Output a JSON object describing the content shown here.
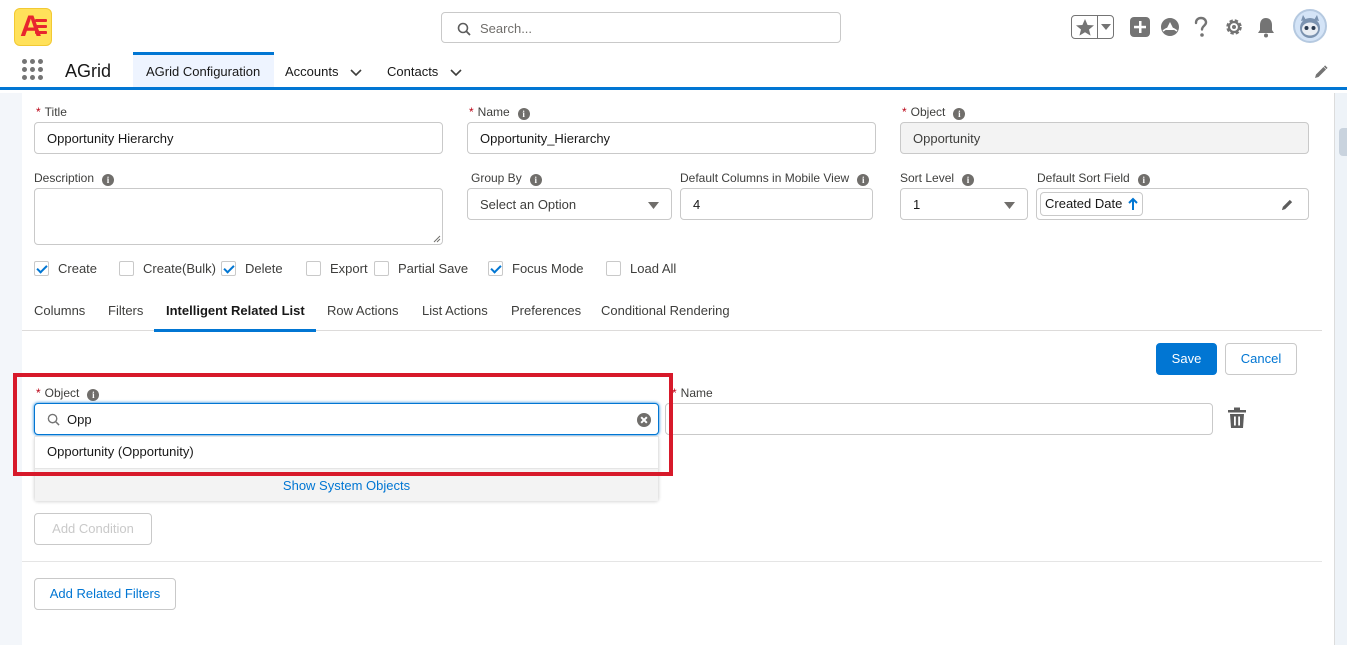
{
  "header": {
    "search_placeholder": "Search...",
    "icons": [
      "favorites-star-icon",
      "add-icon",
      "trailhead-icon",
      "help-icon",
      "setup-gear-icon",
      "notifications-bell-icon",
      "user-avatar"
    ]
  },
  "nav": {
    "app_name": "AGrid",
    "tabs": [
      {
        "label": "AGrid Configuration",
        "active": true
      },
      {
        "label": "Accounts",
        "has_menu": true
      },
      {
        "label": "Contacts",
        "has_menu": true
      }
    ]
  },
  "form": {
    "title": {
      "label": "Title",
      "required": true,
      "value": "Opportunity Hierarchy"
    },
    "name": {
      "label": "Name",
      "required": true,
      "value": "Opportunity_Hierarchy"
    },
    "object": {
      "label": "Object",
      "required": true,
      "value": "Opportunity"
    },
    "description": {
      "label": "Description",
      "value": ""
    },
    "group_by": {
      "label": "Group By",
      "placeholder": "Select an Option"
    },
    "mobile_columns": {
      "label": "Default Columns in Mobile View",
      "value": "4"
    },
    "sort_level": {
      "label": "Sort Level",
      "value": "1"
    },
    "sort_field": {
      "label": "Default Sort Field",
      "value": "Created Date",
      "direction": "ascending"
    },
    "checkboxes": [
      {
        "label": "Create",
        "checked": true
      },
      {
        "label": "Create(Bulk)",
        "checked": false
      },
      {
        "label": "Delete",
        "checked": true
      },
      {
        "label": "Export",
        "checked": false
      },
      {
        "label": "Partial Save",
        "checked": false
      },
      {
        "label": "Focus Mode",
        "checked": true
      },
      {
        "label": "Load All",
        "checked": false
      }
    ]
  },
  "subtabs": [
    {
      "label": "Columns"
    },
    {
      "label": "Filters"
    },
    {
      "label": "Intelligent Related List",
      "active": true
    },
    {
      "label": "Row Actions"
    },
    {
      "label": "List Actions"
    },
    {
      "label": "Preferences"
    },
    {
      "label": "Conditional Rendering"
    }
  ],
  "related_list": {
    "save_label": "Save",
    "cancel_label": "Cancel",
    "object_label": "Object",
    "object_search_value": "Opp",
    "object_option": "Opportunity (Opportunity)",
    "show_system_objects": "Show System Objects",
    "name_label": "Name",
    "name_value": "",
    "add_condition_label": "Add Condition",
    "add_related_filters_label": "Add Related Filters"
  },
  "colors": {
    "brand": "#0176d3",
    "highlight": "#d7192a",
    "required": "#ba0517"
  }
}
